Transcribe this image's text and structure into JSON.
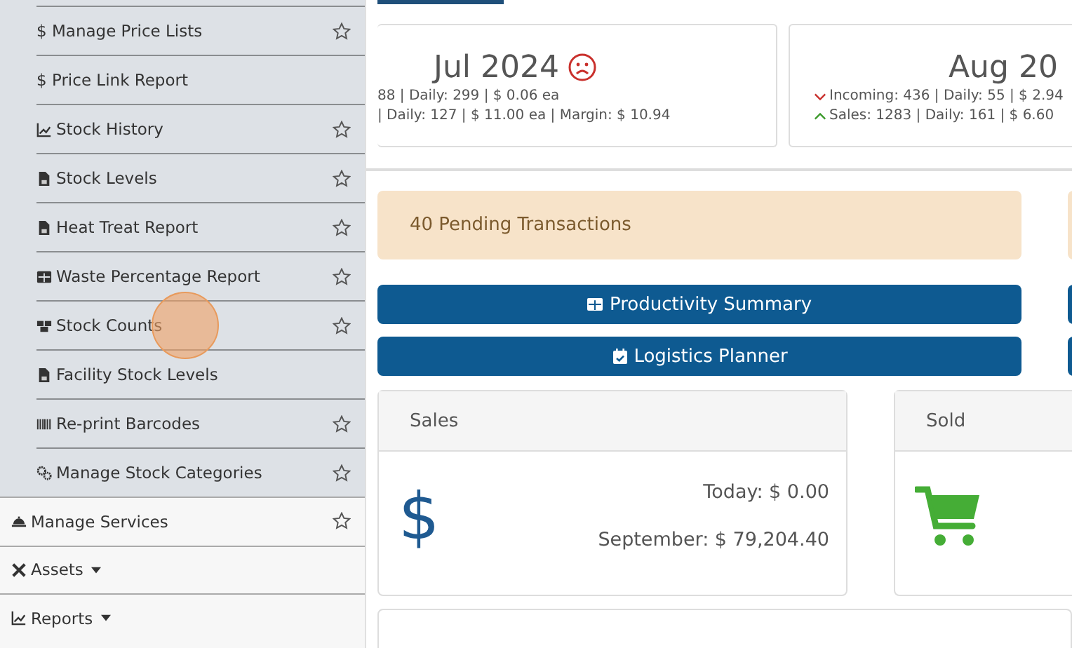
{
  "sidebar": {
    "sub_items": [
      {
        "label": "$ Manage Price Lists",
        "star": true
      },
      {
        "label": "$ Price Link Report",
        "star": false
      },
      {
        "label": "Stock History",
        "star": true
      },
      {
        "label": "Stock Levels",
        "star": true
      },
      {
        "label": "Heat Treat Report",
        "star": true
      },
      {
        "label": "Waste Percentage Report",
        "star": true
      },
      {
        "label": "Stock Counts",
        "star": true
      },
      {
        "label": "Facility Stock Levels",
        "star": false
      },
      {
        "label": "Re-print Barcodes",
        "star": true
      },
      {
        "label": "Manage Stock Categories",
        "star": true
      }
    ],
    "items": [
      {
        "label": "Manage Services",
        "star": true,
        "dropdown": false
      },
      {
        "label": "Assets",
        "star": false,
        "dropdown": true
      },
      {
        "label": "Reports",
        "star": false,
        "dropdown": true
      }
    ]
  },
  "month_cards": [
    {
      "title": "Jul 2024",
      "lines": [
        "88 | Daily: 299 | $ 0.06 ea",
        "| Daily: 127 | $ 11.00 ea | Margin: $ 10.94"
      ]
    },
    {
      "title": "Aug 20",
      "lines": [
        "Incoming: 436 | Daily: 55 | $ 2.94",
        "Sales: 1283 | Daily: 161 | $ 6.60"
      ]
    }
  ],
  "alert": "40 Pending Transactions",
  "buttons": [
    "Productivity Summary",
    "Logistics Planner"
  ],
  "panels": [
    {
      "title": "Sales",
      "icon_text": "$",
      "lines": [
        "Today: $ 0.00",
        "September: $ 79,204.40"
      ]
    },
    {
      "title": "Sold"
    }
  ]
}
